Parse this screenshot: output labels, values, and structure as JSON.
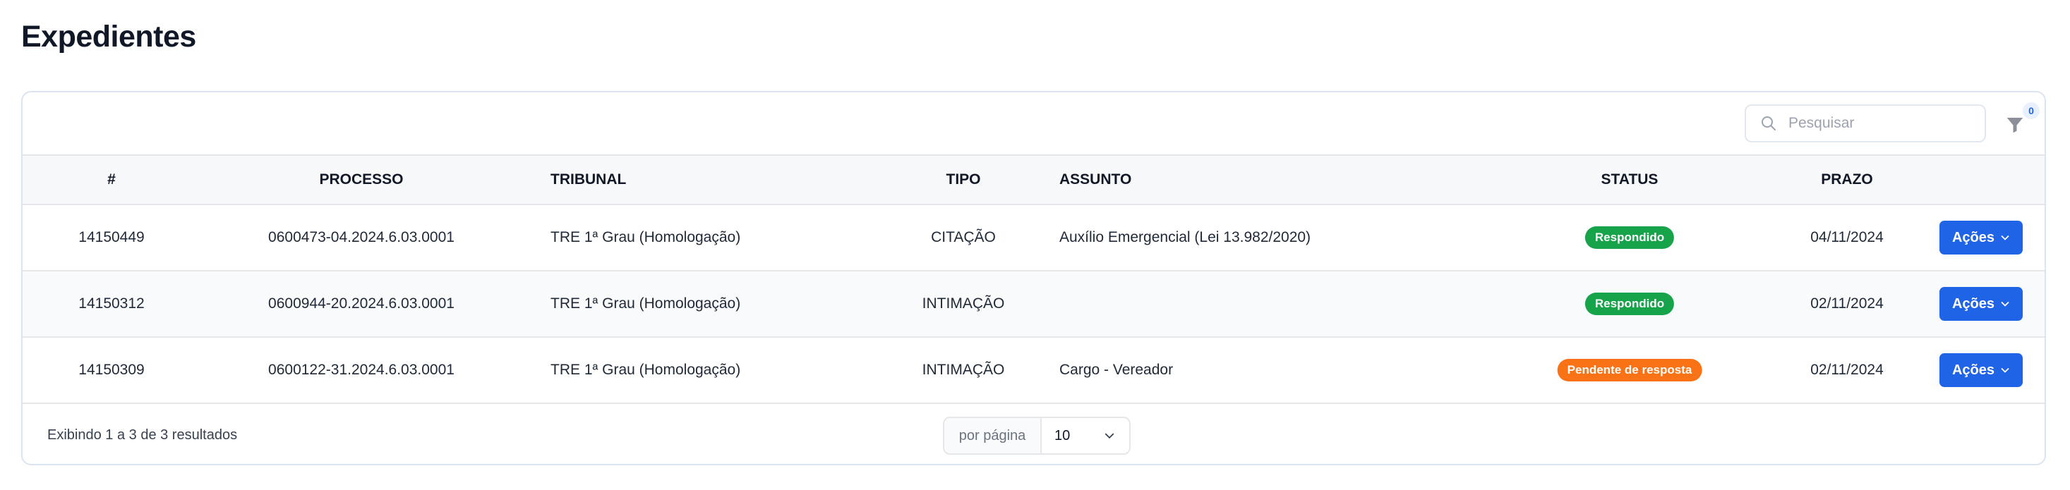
{
  "page": {
    "title": "Expedientes"
  },
  "toolbar": {
    "search_placeholder": "Pesquisar",
    "filter_count": "0"
  },
  "columns": [
    "#",
    "PROCESSO",
    "TRIBUNAL",
    "TIPO",
    "ASSUNTO",
    "STATUS",
    "PRAZO"
  ],
  "rows": [
    {
      "id": "14150449",
      "processo": "0600473-04.2024.6.03.0001",
      "tribunal": "TRE 1ª Grau (Homologação)",
      "tipo": "CITAÇÃO",
      "assunto": "Auxílio Emergencial (Lei 13.982/2020)",
      "status": "Respondido",
      "prazo": "04/11/2024",
      "action": "Ações"
    },
    {
      "id": "14150312",
      "processo": "0600944-20.2024.6.03.0001",
      "tribunal": "TRE 1ª Grau (Homologação)",
      "tipo": "INTIMAÇÃO",
      "assunto": "",
      "status": "Respondido",
      "prazo": "02/11/2024",
      "action": "Ações"
    },
    {
      "id": "14150309",
      "processo": "0600122-31.2024.6.03.0001",
      "tribunal": "TRE 1ª Grau (Homologação)",
      "tipo": "INTIMAÇÃO",
      "assunto": "Cargo - Vereador",
      "status": "Pendente de resposta",
      "prazo": "02/11/2024",
      "action": "Ações"
    }
  ],
  "status_colors": {
    "Respondido": "#16a34a",
    "Pendente de resposta": "#f97316"
  },
  "accent_color": "#1f63e6",
  "footer": {
    "summary": "Exibindo 1 a 3 de 3 resultados",
    "per_page_label": "por página",
    "per_page_value": "10"
  },
  "icons": {
    "search": "search-icon",
    "filter": "filter-icon",
    "chevron": "chevron-down-icon"
  }
}
